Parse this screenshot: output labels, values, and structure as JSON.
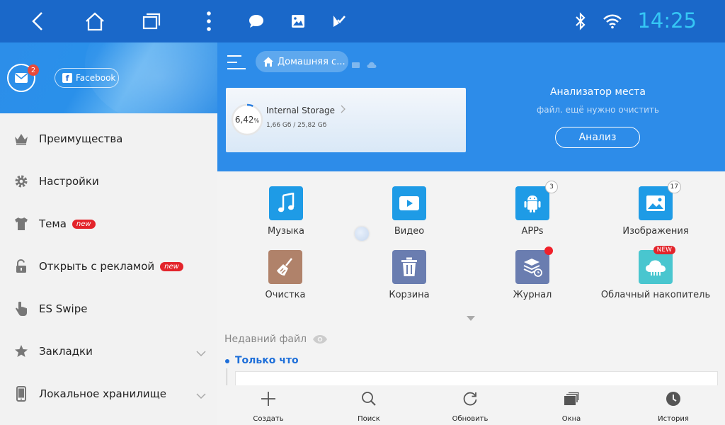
{
  "statusbar": {
    "time": "14:25",
    "icons": [
      "back-icon",
      "home-icon",
      "recent-apps-icon",
      "more-vert-icon",
      "chat-icon",
      "image-icon",
      "tasks-icon",
      "bluetooth-icon",
      "wifi-icon"
    ]
  },
  "sidebar": {
    "mail_badge": "2",
    "facebook_label": "Facebook",
    "items": [
      {
        "label": "Преимущества",
        "icon": "crown-icon"
      },
      {
        "label": "Настройки",
        "icon": "gear-icon"
      },
      {
        "label": "Тема",
        "icon": "shirt-icon",
        "badge": "new"
      },
      {
        "label": "Открыть с рекламой",
        "icon": "unlock-icon",
        "badge": "new"
      },
      {
        "label": "ES Swipe",
        "icon": "swipe-hand-icon"
      },
      {
        "label": "Закладки",
        "icon": "star-icon"
      },
      {
        "label": "Локальное хранилище",
        "icon": "phone-icon"
      }
    ]
  },
  "main": {
    "breadcrumb": "Домашняя с...",
    "storage": {
      "percent": "6,42",
      "percent_sign": "%",
      "percent_value": 6.42,
      "title": "Internal Storage",
      "usage": "1,66 Gб / 25,82 Gб"
    },
    "analyzer": {
      "title": "Анализатор места",
      "subtitle": "файл. ещё нужно очистить",
      "button": "Анализ"
    },
    "categories": [
      {
        "label": "Музыка",
        "icon": "music-icon",
        "color": "#1e9be6"
      },
      {
        "label": "Видео",
        "icon": "video-icon",
        "color": "#1e9be6"
      },
      {
        "label": "APPs",
        "icon": "android-icon",
        "color": "#1e9be6",
        "count": "3"
      },
      {
        "label": "Изображения",
        "icon": "picture-icon",
        "color": "#1e9be6",
        "count": "17"
      },
      {
        "label": "Очистка",
        "icon": "broom-icon",
        "color": "#b0826a"
      },
      {
        "label": "Корзина",
        "icon": "trash-icon",
        "color": "#6a7db0"
      },
      {
        "label": "Журнал",
        "icon": "log-icon",
        "color": "#6a7db0"
      },
      {
        "label": "Облачный накопитель",
        "icon": "cloud-icon",
        "color": "#49c6cf",
        "tag": "NEW"
      }
    ],
    "recent_label": "Недавний файл",
    "just_now": "Только что"
  },
  "bottombar": {
    "items": [
      {
        "label": "Создать",
        "icon": "plus-icon"
      },
      {
        "label": "Поиск",
        "icon": "search-icon"
      },
      {
        "label": "Обновить",
        "icon": "refresh-icon"
      },
      {
        "label": "Окна",
        "icon": "windows-icon"
      },
      {
        "label": "История",
        "icon": "history-icon"
      }
    ]
  },
  "colors": {
    "statusbar": "#1a68c9",
    "main_blue": "#2d8ce9",
    "clock": "#35c7f5",
    "badge_red": "#e3242b",
    "accent": "#1e6fd9"
  }
}
